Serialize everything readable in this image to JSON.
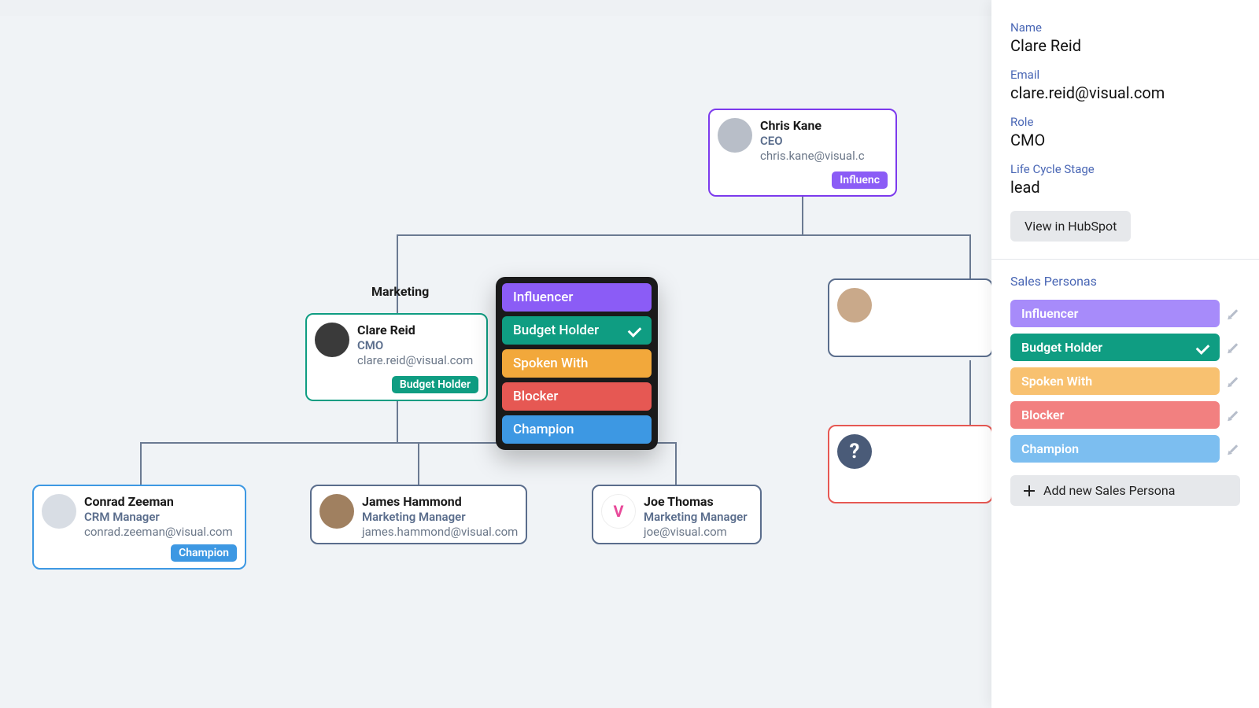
{
  "dept_label": "Marketing",
  "cards": {
    "ceo": {
      "name": "Chris Kane",
      "role": "CEO",
      "email": "chris.kane@visual.com",
      "badge": "Influencer"
    },
    "cmo": {
      "name": "Clare Reid",
      "role": "CMO",
      "email": "clare.reid@visual.com",
      "badge": "Budget Holder"
    },
    "crm": {
      "name": "Conrad Zeeman",
      "role": "CRM Manager",
      "email": "conrad.zeeman@visual.com",
      "badge": "Champion"
    },
    "mm1": {
      "name": "James Hammond",
      "role": "Marketing Manager",
      "email": "james.hammond@visual.com"
    },
    "mm2": {
      "name": "Joe Thomas",
      "role": "Marketing Manager",
      "email": "joe@visual.com"
    }
  },
  "popup": {
    "items": [
      {
        "label": "Influencer"
      },
      {
        "label": "Budget Holder"
      },
      {
        "label": "Spoken With"
      },
      {
        "label": "Blocker"
      },
      {
        "label": "Champion"
      }
    ]
  },
  "panel": {
    "labels": {
      "name": "Name",
      "email": "Email",
      "role": "Role",
      "stage": "Life Cycle Stage",
      "view_btn": "View in HubSpot",
      "section": "Sales Personas",
      "add": "Add new Sales Persona"
    },
    "values": {
      "name": "Clare Reid",
      "email": "clare.reid@visual.com",
      "role": "CMO",
      "stage": "lead"
    },
    "personas": [
      {
        "label": "Influencer"
      },
      {
        "label": "Budget Holder"
      },
      {
        "label": "Spoken With"
      },
      {
        "label": "Blocker"
      },
      {
        "label": "Champion"
      }
    ]
  }
}
